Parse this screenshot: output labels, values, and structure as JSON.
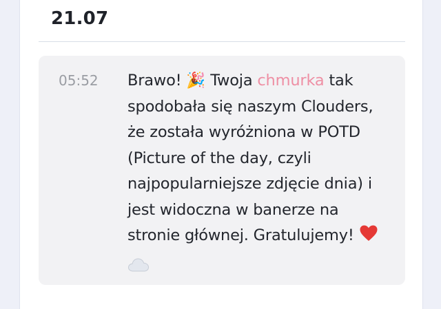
{
  "date_heading": "21.07",
  "message": {
    "time": "05:52",
    "text_before_link": "Brawo! ",
    "party_emoji": "🎉",
    "text_after_emoji": " Twoja ",
    "link_text": "chmurka",
    "text_after_link": " tak spodobała się naszym Clouders, że została wyróżniona w POTD (Picture of the day, czyli najpopularniejsze zdjęcie dnia) i jest widoczna w banerze na stronie głównej. Gratulujemy! ",
    "heart_emoji": "❤️",
    "cloud_emoji": "☁️"
  },
  "colors": {
    "link": "#ee8fa4",
    "bubble_bg": "#f2f2f4",
    "time": "#9a9da3",
    "heart": "#e53935"
  }
}
